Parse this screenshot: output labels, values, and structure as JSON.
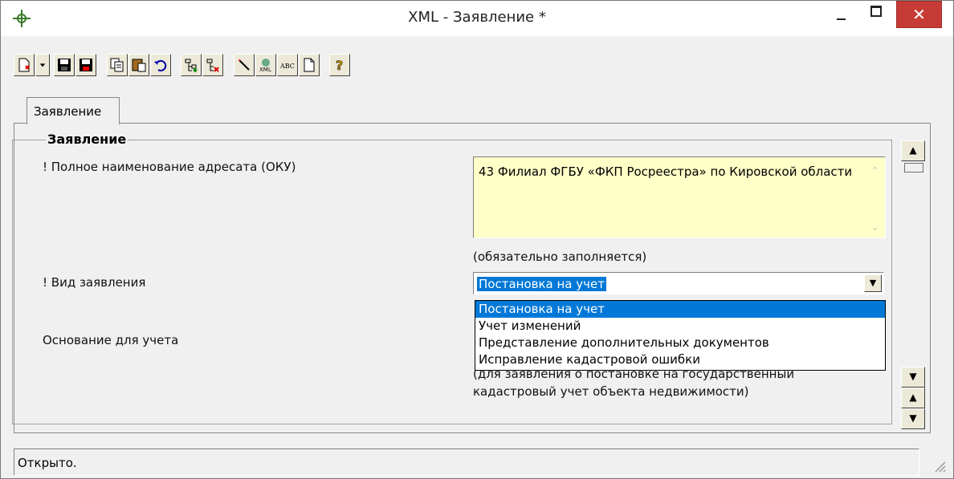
{
  "window": {
    "title": "XML - Заявление *",
    "controls": {
      "minimize": "–",
      "maximize": "□",
      "close": "✕"
    }
  },
  "toolbar": {
    "buttons": [
      "new-document-icon",
      "dropdown-arrow-icon",
      "save-icon",
      "save-as-icon",
      "copy-icon",
      "paste-icon",
      "undo-icon",
      "add-node-icon",
      "delete-node-icon",
      "wand-icon",
      "xml-icon",
      "spellcheck-icon",
      "document-icon",
      "help-icon"
    ]
  },
  "tabs": [
    {
      "label": "Заявление"
    }
  ],
  "group": {
    "title": "Заявление",
    "fields": {
      "addressee_label": "! Полное наименование адресата (ОКУ)",
      "addressee_value": "43 Филиал ФГБУ «ФКП Росреестра» по Кировской области",
      "addressee_note": "(обязательно заполняется)",
      "kind_label": "! Вид заявления",
      "kind_value": "Постановка на учет",
      "basis_label": "Основание для учета",
      "basis_hint_1": "(для заявления о постановке на государственный",
      "basis_hint_2": "кадастровый учет объекта недвижимости)"
    },
    "kind_options": [
      "Постановка на учет",
      "Учет изменений",
      "Представление дополнительных документов",
      "Исправление кадастровой ошибки"
    ]
  },
  "status": {
    "text": "Открыто."
  },
  "colors": {
    "memo_bg": "#ffffc8",
    "selection": "#0078d7",
    "close_btn": "#c73b37"
  }
}
